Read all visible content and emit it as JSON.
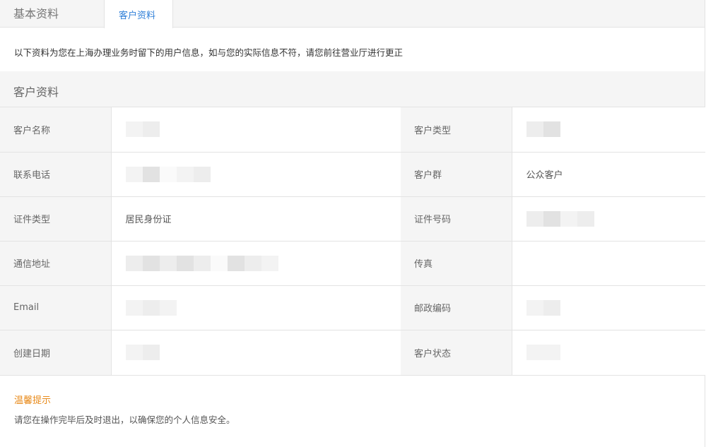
{
  "tabs": [
    {
      "label": "基本资料",
      "active": false
    },
    {
      "label": "客户资料",
      "active": true
    }
  ],
  "notice": "以下资料为您在上海办理业务时留下的用户信息，如与您的实际信息不符，请您前往营业厅进行更正",
  "section_title": "客户资料",
  "rows": [
    {
      "l1": "客户名称",
      "v1": "",
      "l2": "客户类型",
      "v2": ""
    },
    {
      "l1": "联系电话",
      "v1": "",
      "l2": "客户群",
      "v2": "公众客户"
    },
    {
      "l1": "证件类型",
      "v1": "居民身份证",
      "l2": "证件号码",
      "v2": ""
    },
    {
      "l1": "通信地址",
      "v1": "",
      "l2": "传真",
      "v2": ""
    },
    {
      "l1": "Email",
      "v1": "",
      "l2": "邮政编码",
      "v2": ""
    },
    {
      "l1": "创建日期",
      "v1": "",
      "l2": "客户状态",
      "v2": ""
    }
  ],
  "tips": {
    "title": "温馨提示",
    "text": "请您在操作完毕后及时退出，以确保您的个人信息安全。"
  },
  "colors": {
    "accent_blue": "#2f7fd8",
    "tip_orange": "#e88a1a",
    "panel_gray": "#f5f5f5",
    "border": "#e3e3e3"
  }
}
